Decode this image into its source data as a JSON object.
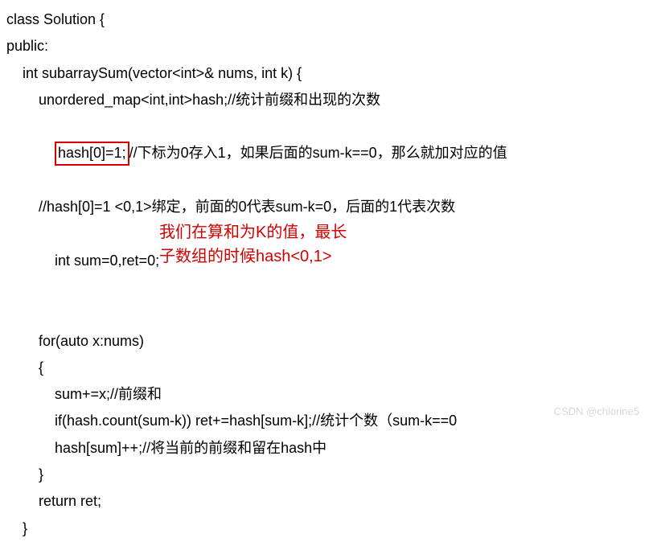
{
  "code": {
    "l1": "class Solution {",
    "l2": "public:",
    "l3": "int subarraySum(vector<int>& nums, int k) {",
    "l4": "unordered_map<int,int>hash;//统计前缀和出现的次数",
    "l5a": "hash[0]=1;",
    "l5b": "//下标为0存入1，如果后面的sum-k==0，那么就加对应的值",
    "l6": "//hash[0]=1 <0,1>绑定，前面的0代表sum-k=0，后面的1代表次数",
    "l7": "int sum=0,ret=0;",
    "l8": "for(auto x:nums)",
    "l9": "{",
    "l10": "sum+=x;//前缀和",
    "l11": "if(hash.count(sum-k)) ret+=hash[sum-k];//统计个数（sum-k==0",
    "l12": "hash[sum]++;//将当前的前缀和留在hash中",
    "l13": "}",
    "l14": "return ret;",
    "l15": "}"
  },
  "annotation": {
    "line1": "我们在算和为K的值，最长",
    "line2": "子数组的时候hash<0,1>"
  },
  "watermark": "CSDN @chlorine5"
}
